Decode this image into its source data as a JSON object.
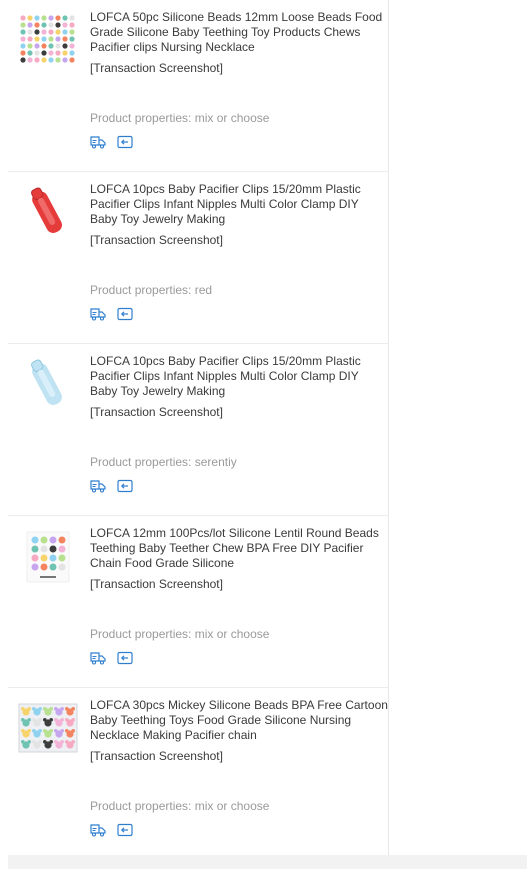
{
  "order_items": [
    {
      "title": "LOFCA 50pc Silicone Beads 12mm Loose Beads Food Grade Silicone Baby Teething Toy Products Chews Pacifier clips Nursing Necklace",
      "snapshot_label": "[Transaction Screenshot]",
      "properties": "Product properties: mix or choose",
      "thumb": "bead-grid"
    },
    {
      "title": "LOFCA 10pcs Baby Pacifier Clips 15/20mm Plastic Pacifier Clips Infant Nipples Multi Color Clamp DIY Baby Toy Jewelry Making",
      "snapshot_label": "[Transaction Screenshot]",
      "properties": "Product properties: red",
      "thumb": "red-clip"
    },
    {
      "title": "LOFCA 10pcs Baby Pacifier Clips 15/20mm Plastic Pacifier Clips Infant Nipples Multi Color Clamp DIY Baby Toy Jewelry Making",
      "snapshot_label": "[Transaction Screenshot]",
      "properties": "Product properties: serentiy",
      "thumb": "blue-clip"
    },
    {
      "title": "LOFCA 12mm 100Pcs/lot Silicone Lentil Round Beads Teething Baby Teether Chew BPA Free DIY Pacifier Chain Food Grade Silicone",
      "snapshot_label": "[Transaction Screenshot]",
      "properties": "Product properties: mix or choose",
      "thumb": "lentil-card"
    },
    {
      "title": "LOFCA 30pcs Mickey Silicone Beads BPA Free Cartoon Baby Teething Toys Food Grade Silicone Nursing Necklace Making Pacifier chain",
      "snapshot_label": "[Transaction Screenshot]",
      "properties": "Product properties: mix or choose",
      "thumb": "mickey-box"
    }
  ],
  "icons": {
    "shipping": "truck-icon",
    "return": "return-icon",
    "color": "#2f7fd1"
  }
}
